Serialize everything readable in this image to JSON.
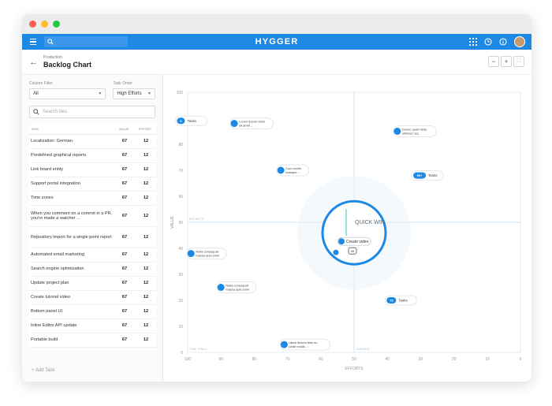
{
  "app": {
    "brand": "HYGGER"
  },
  "header": {
    "breadcrumb": "Production",
    "title": "Backlog Chart",
    "zoom_out": "−",
    "zoom_in": "+"
  },
  "filters": {
    "column_filter_label": "Column Filter",
    "column_filter_value": "All",
    "task_order_label": "Task Order",
    "task_order_value": "High Efforts",
    "search_placeholder": "Search tiles"
  },
  "table": {
    "headers": [
      "TASK",
      "VALUE",
      "EFFORT"
    ],
    "rows": [
      {
        "task": "Localization: German",
        "value": "67",
        "effort": "12"
      },
      {
        "task": "Predefined graphical reports",
        "value": "67",
        "effort": "12"
      },
      {
        "task": "Link board entity",
        "value": "67",
        "effort": "12"
      },
      {
        "task": "Support portal integration",
        "value": "67",
        "effort": "12"
      },
      {
        "task": "Time zones",
        "value": "67",
        "effort": "12"
      },
      {
        "task": "When you comment on a commit in a PR, you're made a watcher ...",
        "value": "67",
        "effort": "12"
      },
      {
        "task": "Repository import for a single point report",
        "value": "67",
        "effort": "12"
      },
      {
        "task": "Automated email marketing",
        "value": "67",
        "effort": "12"
      },
      {
        "task": "Search engine optimization",
        "value": "67",
        "effort": "12"
      },
      {
        "task": "Update project plan",
        "value": "67",
        "effort": "12"
      },
      {
        "task": "Create tutorial video",
        "value": "67",
        "effort": "12"
      },
      {
        "task": "Bottom panel UI",
        "value": "67",
        "effort": "12"
      },
      {
        "task": "Inline Editor API update",
        "value": "67",
        "effort": "12"
      },
      {
        "task": "Portable build",
        "value": "67",
        "effort": "12"
      }
    ],
    "add_task": "+ Add Task"
  },
  "chart_data": {
    "type": "scatter",
    "xlabel": "EFFORTS",
    "ylabel": "VALUE",
    "xlim": [
      100,
      0
    ],
    "ylim": [
      0,
      100
    ],
    "x_ticks": [
      "100",
      "90",
      "80",
      "70",
      "60",
      "50",
      "40",
      "30",
      "20",
      "10",
      "0"
    ],
    "y_ticks": [
      "0",
      "10",
      "20",
      "30",
      "40",
      "50",
      "60",
      "70",
      "80",
      "90",
      "100"
    ],
    "quadrants": {
      "top_left": "BIG BETS",
      "bottom_left": "TIME SINKS",
      "bottom_right": "MAYBES",
      "top_right": "QUICK WIN"
    },
    "points": [
      {
        "label": "Lorem ipsum dolor sit amet ...",
        "x": 86,
        "y": 88
      },
      {
        "label": "Donec quam felis, ultricies nec.",
        "x": 37,
        "y": 85
      },
      {
        "label": "Cum sociis natoque ...",
        "x": 72,
        "y": 70
      },
      {
        "label": "Nulla consequat massa quis enim",
        "x": 99,
        "y": 38
      },
      {
        "label": "Nulla consequat massa quis enim",
        "x": 90,
        "y": 25
      },
      {
        "label": "ullam dictum felis eu pede mollis ...",
        "x": 71,
        "y": 3
      }
    ],
    "clusters": [
      {
        "badge": "Tasks",
        "count": "6",
        "x": 98,
        "y": 89
      },
      {
        "badge": "Tasks",
        "count": "59+",
        "x": 27,
        "y": 68
      },
      {
        "badge": "Tasks",
        "count": "73",
        "x": 35,
        "y": 20
      }
    ],
    "highlight": {
      "label": "Create video",
      "cursor": "Hit"
    }
  }
}
